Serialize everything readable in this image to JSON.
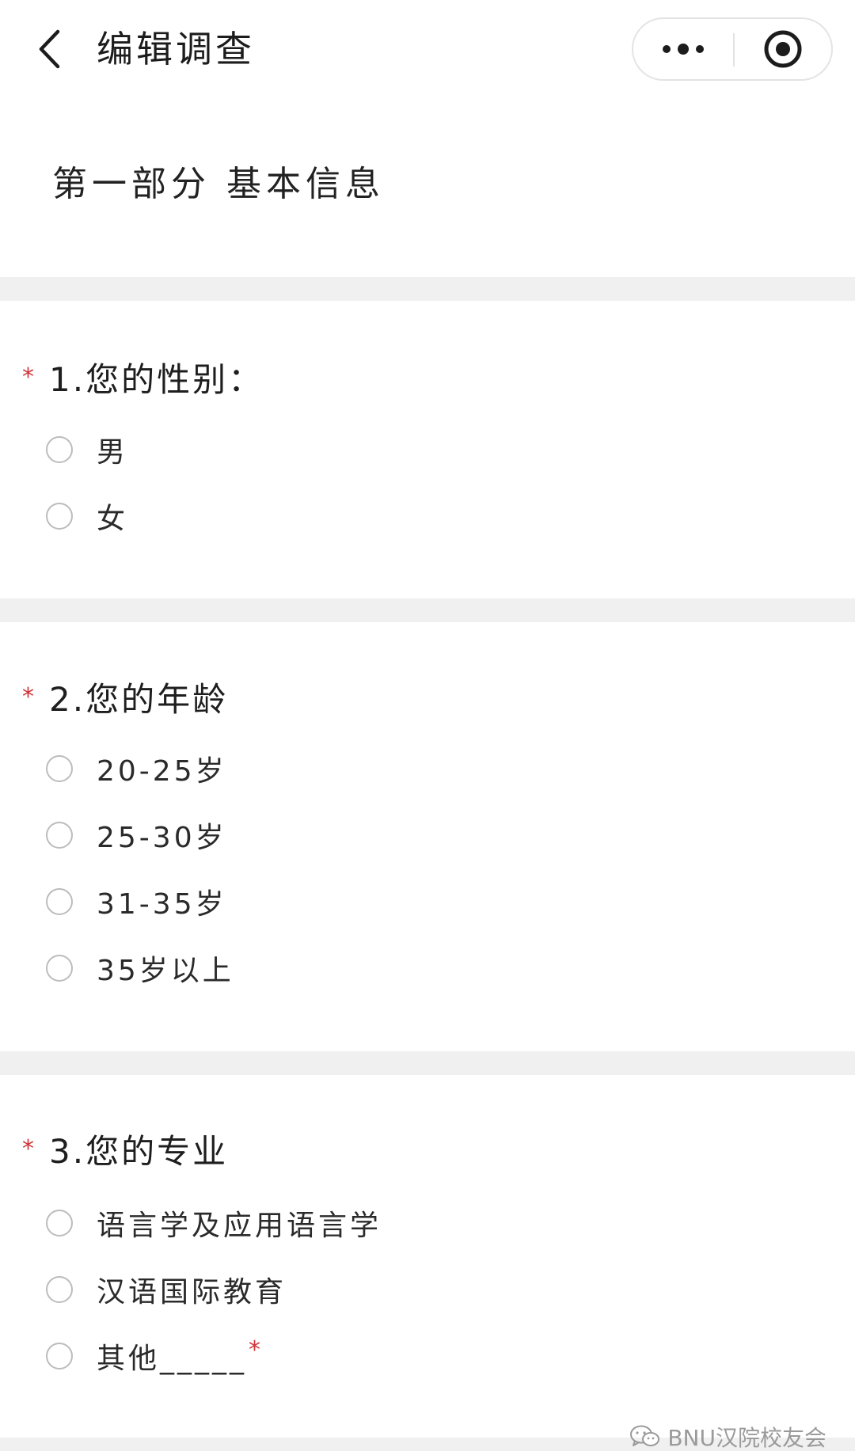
{
  "header": {
    "title": "编辑调查",
    "more_icon": "more-dots-icon",
    "close_icon": "target-icon",
    "back_icon": "chevron-left-icon"
  },
  "part_heading": "第一部分  基本信息",
  "questions": [
    {
      "required": true,
      "star": "*",
      "title": "1.您的性别：",
      "options": [
        "男",
        "女"
      ]
    },
    {
      "required": true,
      "star": "*",
      "title": "2.您的年龄",
      "options": [
        "20-25岁",
        "25-30岁",
        "31-35岁",
        "35岁以上"
      ]
    },
    {
      "required": true,
      "star": "*",
      "title": "3.您的专业",
      "options": [
        "语言学及应用语言学",
        "汉语国际教育",
        "其他_____"
      ],
      "other_star": "*"
    }
  ],
  "watermark": {
    "text": "BNU汉院校友会",
    "icon": "wechat-icon"
  },
  "colors": {
    "required_star": "#d0343a",
    "separator": "#f0f0f0",
    "radio_border": "#bcbcbc"
  }
}
